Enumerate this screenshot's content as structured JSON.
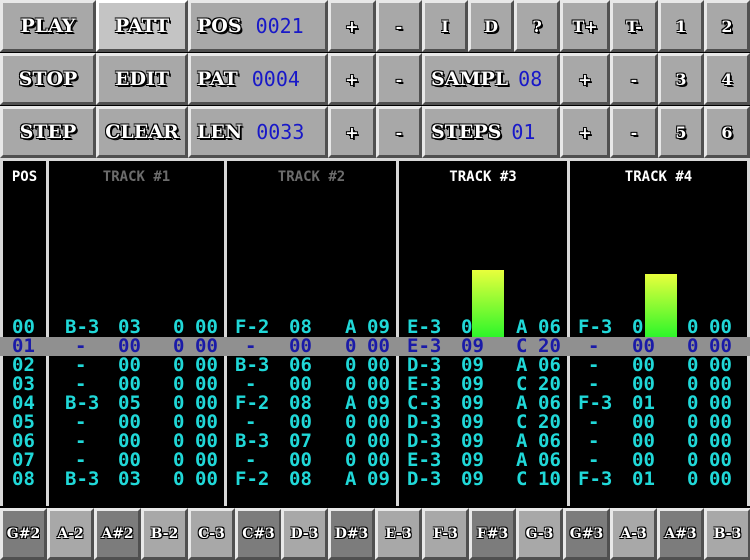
{
  "controls": {
    "play": "PLAY",
    "stop": "STOP",
    "step": "STEP",
    "patt": "PATT",
    "edit": "EDIT",
    "clear": "CLEAR",
    "pos_label": "POS",
    "pos_value": "0021",
    "pat_label": "PAT",
    "pat_value": "0004",
    "len_label": "LEN",
    "len_value": "0033",
    "plus": "+",
    "minus": "-",
    "i": "I",
    "d": "D",
    "q": "?",
    "tplus": "T+",
    "tminus": "T-",
    "sampl_label": "SAMPL",
    "sampl_value": "08",
    "steps_label": "STEPS",
    "steps_value": "01",
    "n1": "1",
    "n2": "2",
    "n3": "3",
    "n4": "4",
    "n5": "5",
    "n6": "6"
  },
  "tracker": {
    "pos_header": "POS",
    "tracks": [
      "TRACK #1",
      "TRACK #2",
      "TRACK #3",
      "TRACK #4"
    ],
    "track_muted": [
      true,
      true,
      false,
      false
    ],
    "vu_levels": [
      0,
      0,
      0.9,
      0.85
    ],
    "rows": [
      {
        "pos": "00",
        "t": [
          [
            "B-3",
            "03",
            "0",
            "00"
          ],
          [
            "F-2",
            "08",
            "A",
            "09"
          ],
          [
            "E-3",
            "0",
            "A",
            "06"
          ],
          [
            "F-3",
            "0",
            "0",
            "00"
          ]
        ]
      },
      {
        "pos": "01",
        "t": [
          [
            "-",
            "00",
            "0",
            "00"
          ],
          [
            "-",
            "00",
            "0",
            "00"
          ],
          [
            "E-3",
            "09",
            "C",
            "20"
          ],
          [
            "-",
            "00",
            "0",
            "00"
          ]
        ]
      },
      {
        "pos": "02",
        "t": [
          [
            "-",
            "00",
            "0",
            "00"
          ],
          [
            "B-3",
            "06",
            "0",
            "00"
          ],
          [
            "D-3",
            "09",
            "A",
            "06"
          ],
          [
            "-",
            "00",
            "0",
            "00"
          ]
        ]
      },
      {
        "pos": "03",
        "t": [
          [
            "-",
            "00",
            "0",
            "00"
          ],
          [
            "-",
            "00",
            "0",
            "00"
          ],
          [
            "E-3",
            "09",
            "C",
            "20"
          ],
          [
            "-",
            "00",
            "0",
            "00"
          ]
        ]
      },
      {
        "pos": "04",
        "t": [
          [
            "B-3",
            "05",
            "0",
            "00"
          ],
          [
            "F-2",
            "08",
            "A",
            "09"
          ],
          [
            "C-3",
            "09",
            "A",
            "06"
          ],
          [
            "F-3",
            "01",
            "0",
            "00"
          ]
        ]
      },
      {
        "pos": "05",
        "t": [
          [
            "-",
            "00",
            "0",
            "00"
          ],
          [
            "-",
            "00",
            "0",
            "00"
          ],
          [
            "D-3",
            "09",
            "C",
            "20"
          ],
          [
            "-",
            "00",
            "0",
            "00"
          ]
        ]
      },
      {
        "pos": "06",
        "t": [
          [
            "-",
            "00",
            "0",
            "00"
          ],
          [
            "B-3",
            "07",
            "0",
            "00"
          ],
          [
            "D-3",
            "09",
            "A",
            "06"
          ],
          [
            "-",
            "00",
            "0",
            "00"
          ]
        ]
      },
      {
        "pos": "07",
        "t": [
          [
            "-",
            "00",
            "0",
            "00"
          ],
          [
            "-",
            "00",
            "0",
            "00"
          ],
          [
            "E-3",
            "09",
            "A",
            "06"
          ],
          [
            "-",
            "00",
            "0",
            "00"
          ]
        ]
      },
      {
        "pos": "08",
        "t": [
          [
            "B-3",
            "03",
            "0",
            "00"
          ],
          [
            "F-2",
            "08",
            "A",
            "09"
          ],
          [
            "D-3",
            "09",
            "C",
            "10"
          ],
          [
            "F-3",
            "01",
            "0",
            "00"
          ]
        ]
      }
    ],
    "current_row": 1
  },
  "keys": [
    {
      "label": "G#2",
      "sharp": true
    },
    {
      "label": "A-2",
      "sharp": false
    },
    {
      "label": "A#2",
      "sharp": true
    },
    {
      "label": "B-2",
      "sharp": false
    },
    {
      "label": "C-3",
      "sharp": false
    },
    {
      "label": "C#3",
      "sharp": true
    },
    {
      "label": "D-3",
      "sharp": false
    },
    {
      "label": "D#3",
      "sharp": true
    },
    {
      "label": "E-3",
      "sharp": false
    },
    {
      "label": "F-3",
      "sharp": false
    },
    {
      "label": "F#3",
      "sharp": true
    },
    {
      "label": "G-3",
      "sharp": false
    },
    {
      "label": "G#3",
      "sharp": true
    },
    {
      "label": "A-3",
      "sharp": false
    },
    {
      "label": "A#3",
      "sharp": true
    },
    {
      "label": "B-3",
      "sharp": false
    }
  ],
  "colors": {
    "note": "#20d8d8",
    "current_text": "#1a1aa8",
    "value": "#1818c8",
    "button": "#a8a8a8"
  }
}
